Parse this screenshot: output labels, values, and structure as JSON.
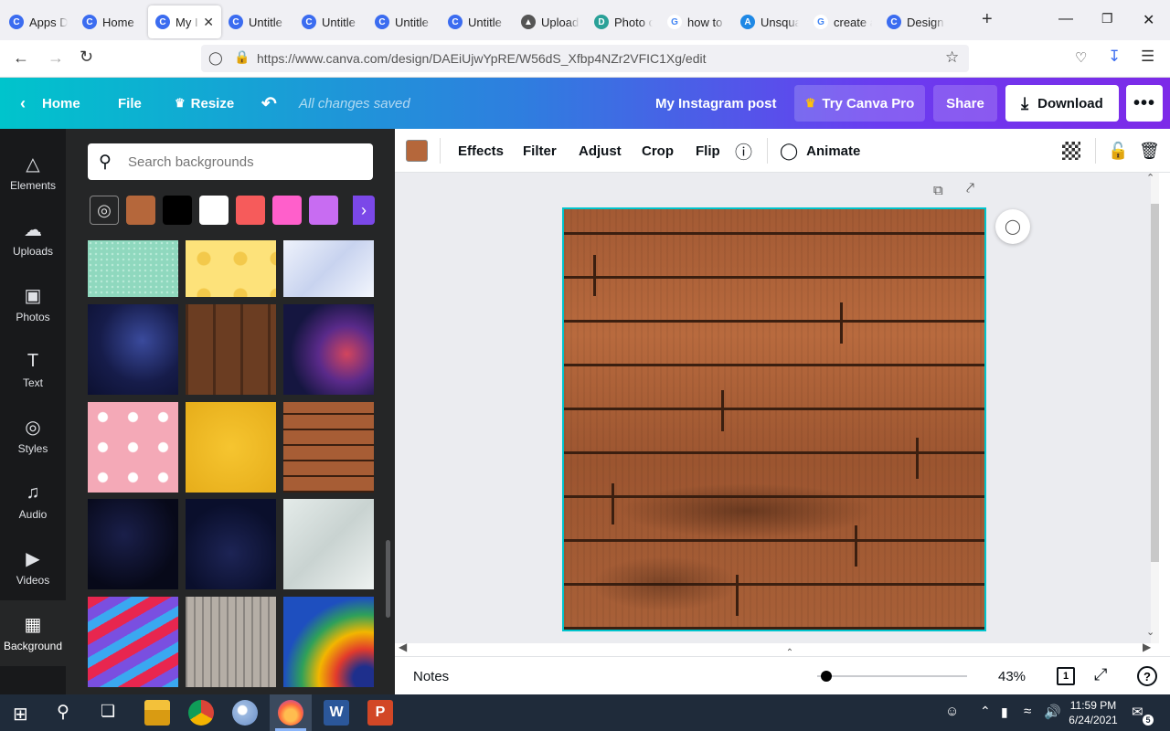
{
  "browser": {
    "tabs": [
      {
        "label": "Apps D",
        "icon": "canva-icon"
      },
      {
        "label": "Home",
        "icon": "canva-icon"
      },
      {
        "label": "My I",
        "icon": "canva-icon",
        "active": true
      },
      {
        "label": "Untitle",
        "icon": "canva-icon"
      },
      {
        "label": "Untitle",
        "icon": "canva-icon"
      },
      {
        "label": "Untitle",
        "icon": "canva-icon"
      },
      {
        "label": "Untitle",
        "icon": "canva-icon"
      },
      {
        "label": "Upload",
        "icon": "upload-icon"
      },
      {
        "label": "Photo c",
        "icon": "photo-icon"
      },
      {
        "label": "how to",
        "icon": "google-icon"
      },
      {
        "label": "Unsqua",
        "icon": "appstore-icon"
      },
      {
        "label": "create a",
        "icon": "google-icon"
      },
      {
        "label": "Design",
        "icon": "canva-icon"
      }
    ],
    "url": "https://www.canva.com/design/DAEiUjwYpRE/W56dS_Xfbp4NZr2VFIC1Xg/edit"
  },
  "header": {
    "home": "Home",
    "file": "File",
    "resize": "Resize",
    "save_status": "All changes saved",
    "design_title": "My Instagram post",
    "try_pro": "Try Canva Pro",
    "share": "Share",
    "download": "Download"
  },
  "rail": [
    {
      "label": "Elements",
      "icon": "elements-icon"
    },
    {
      "label": "Uploads",
      "icon": "cloud-upload-icon"
    },
    {
      "label": "Photos",
      "icon": "image-icon"
    },
    {
      "label": "Text",
      "icon": "text-icon"
    },
    {
      "label": "Styles",
      "icon": "palette-icon"
    },
    {
      "label": "Audio",
      "icon": "music-icon"
    },
    {
      "label": "Videos",
      "icon": "video-icon"
    },
    {
      "label": "Background",
      "icon": "background-icon",
      "active": true
    }
  ],
  "panel": {
    "search_placeholder": "Search backgrounds",
    "swatches": [
      "#b5673b",
      "#000000",
      "#ffffff",
      "#f65b5b",
      "#ff5fcb",
      "#c86cf2",
      "#7b48e8"
    ]
  },
  "toolbar": {
    "color": "#b5673b",
    "effects": "Effects",
    "filter": "Filter",
    "adjust": "Adjust",
    "crop": "Crop",
    "flip": "Flip",
    "animate": "Animate"
  },
  "bottom": {
    "notes": "Notes",
    "zoom": "43%",
    "page": "1",
    "zoom_level": 0.06
  },
  "taskbar": {
    "time": "11:59 PM",
    "date": "6/24/2021",
    "notifications": "5"
  }
}
